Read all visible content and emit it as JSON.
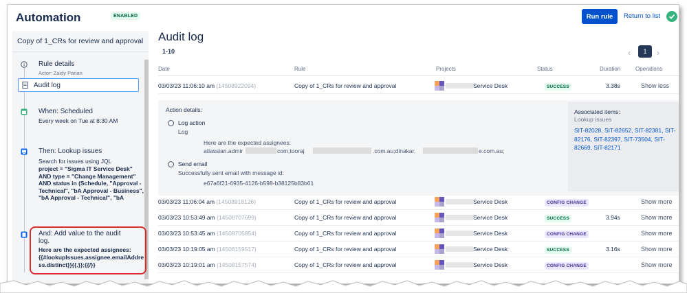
{
  "header": {
    "title": "Automation",
    "status_badge": "ENABLED",
    "run_rule": "Run rule",
    "return_to_list": "Return to list"
  },
  "sidebar": {
    "rule_name": "Copy of 1_CRs for review and approval",
    "rule_details": {
      "title": "Rule details",
      "actor": "Actor: Zaidy Parian"
    },
    "audit_log": "Audit log",
    "trigger": {
      "title": "When: Scheduled",
      "sub": "Every week on Tue at 8:30 AM"
    },
    "lookup": {
      "title": "Then: Lookup issues",
      "line1": "Search for issues using JQL",
      "jql": [
        "project = \"Sigma IT Service Desk\"",
        "AND type = \"Change Management\"",
        "AND status in (Schedule, \"Approval -",
        "Technical\", \"bA Approval - Business\",",
        "\"bA Approval - Technical\", \"bA"
      ]
    },
    "audit": {
      "title_line1": "And: Add value to the audit",
      "title_line2": "log.",
      "body": [
        "Here are the expected assignees:",
        "{{#lookupIssues.assignee.emailAddre",
        "ss.distinct}}{{.}};{{/}}"
      ]
    }
  },
  "main": {
    "title": "Audit log",
    "range": "1-10",
    "page": "1",
    "columns": [
      "Date",
      "Rule",
      "Projects",
      "Status",
      "Duration",
      "Operations"
    ],
    "rows": [
      {
        "date": "03/03/23 11:06:10 am",
        "id": "(14508922094)",
        "rule": "Copy of 1_CRs for review and approval",
        "project": "Service Desk",
        "status": "SUCCESS",
        "duration": "3.38s",
        "op": "Show less"
      },
      {
        "date": "03/03/23 11:06:04 am",
        "id": "(14508918126)",
        "rule": "Copy of 1_CRs for review and approval",
        "project": "Service Desk",
        "status": "CONFIG CHANGE",
        "duration": "",
        "op": "Show more"
      },
      {
        "date": "03/03/23 10:53:49 am",
        "id": "(14508707699)",
        "rule": "Copy of 1_CRs for review and approval",
        "project": "Service Desk",
        "status": "SUCCESS",
        "duration": "3.94s",
        "op": "Show more"
      },
      {
        "date": "03/03/23 10:53:45 am",
        "id": "(14508705854)",
        "rule": "Copy of 1_CRs for review and approval",
        "project": "Service Desk",
        "status": "CONFIG CHANGE",
        "duration": "",
        "op": "Show more"
      },
      {
        "date": "03/03/23 10:19:05 am",
        "id": "(14508159517)",
        "rule": "Copy of 1_CRs for review and approval",
        "project": "Service Desk",
        "status": "SUCCESS",
        "duration": "3.16s",
        "op": "Show more"
      },
      {
        "date": "03/03/23 10:19:01 am",
        "id": "(14508157574)",
        "rule": "Copy of 1_CRs for review and approval",
        "project": "Service Desk",
        "status": "CONFIG CHANGE",
        "duration": "",
        "op": "Show more"
      }
    ],
    "details": {
      "heading": "Action details:",
      "log_action": "Log action",
      "log": "Log",
      "log_text": "Here are the expected assignees:",
      "email_p1": "atlassian.admir",
      "email_p2": "com;tooraj",
      "email_p3": ".com.au;dinakar.",
      "email_p4": "e.com.au;",
      "send_email": "Send email",
      "send_text": "Successfully sent email with message id:",
      "message_id": "e67a6f21-6935-4126-b598-b38125b83b61",
      "associated_title": "Associated items:",
      "associated_sub": "Lookup issues",
      "associated_links": "SIT-82028, SIT-82652, SIT-82381, SIT-82176, SIT-82397, SIT-73504, SIT-82669, SIT-82171"
    }
  }
}
